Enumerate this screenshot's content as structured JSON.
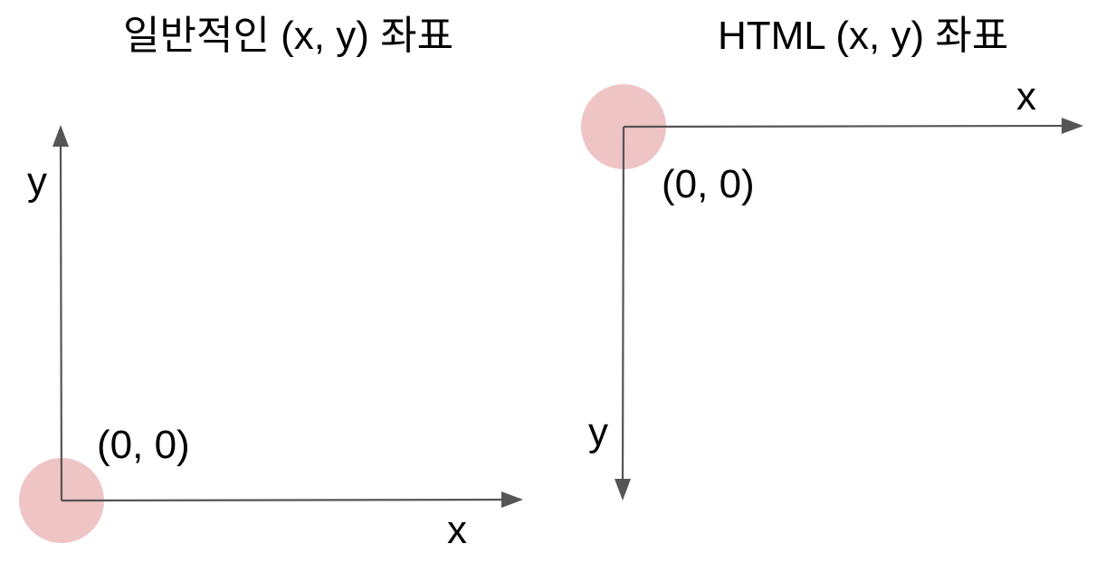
{
  "panels": {
    "general": {
      "title": "일반적인 (x, y) 좌표",
      "origin_label": "(0, 0)",
      "x_label": "x",
      "y_label": "y",
      "y_axis_direction": "up",
      "origin_position": "bottom-left"
    },
    "html": {
      "title": "HTML (x, y) 좌표",
      "origin_label": "(0, 0)",
      "x_label": "x",
      "y_label": "y",
      "y_axis_direction": "down",
      "origin_position": "top-left"
    }
  },
  "colors": {
    "axis": "#555555",
    "origin_marker": "#efc4c5",
    "text": "#000000",
    "background": "#ffffff"
  }
}
